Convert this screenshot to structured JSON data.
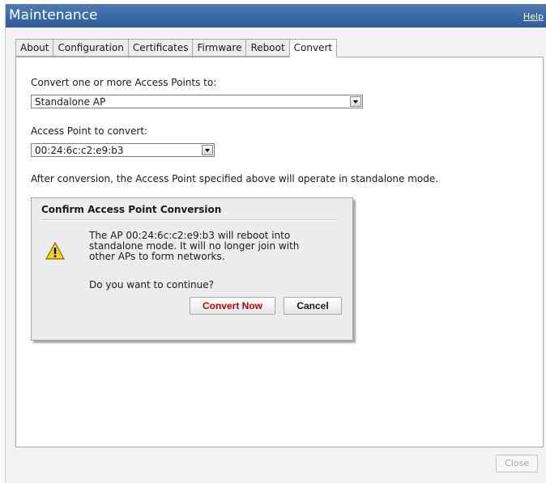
{
  "window": {
    "title": "Maintenance",
    "help_label": "Help"
  },
  "tabs": [
    {
      "label": "About",
      "active": false
    },
    {
      "label": "Configuration",
      "active": false
    },
    {
      "label": "Certificates",
      "active": false
    },
    {
      "label": "Firmware",
      "active": false
    },
    {
      "label": "Reboot",
      "active": false
    },
    {
      "label": "Convert",
      "active": true
    }
  ],
  "convert": {
    "target_label": "Convert one or more Access Points to:",
    "target_value": "Standalone AP",
    "ap_label": "Access Point to convert:",
    "ap_value": "00:24:6c:c2:e9:b3",
    "info_text": "After conversion, the Access Point specified above will operate in standalone mode."
  },
  "dialog": {
    "title": "Confirm Access Point Conversion",
    "icon": "warning-icon",
    "message_line1": "The AP 00:24:6c:c2:e9:b3 will reboot into",
    "message_line2": "standalone mode. It will no longer join with",
    "message_line3": "other APs to form networks.",
    "question": "Do you want to continue?",
    "convert_label": "Convert Now",
    "cancel_label": "Cancel"
  },
  "footer": {
    "close_label": "Close"
  },
  "colors": {
    "titlebar": "#3868a6",
    "convert_button_text": "#cc0000",
    "disabled_text": "#a6a6a6"
  }
}
